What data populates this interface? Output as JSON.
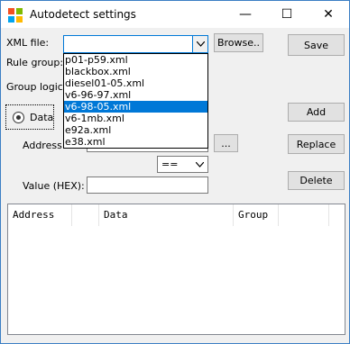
{
  "window": {
    "title": "Autodetect settings",
    "minimize": "—",
    "maximize": "☐",
    "close": "✕"
  },
  "labels": {
    "xml_file": "XML file:",
    "rule_group": "Rule group:",
    "group_logic": "Group logic:",
    "data": "Data",
    "address": "Address:",
    "value_hex": "Value (HEX):"
  },
  "buttons": {
    "browse": "Browse..",
    "save": "Save",
    "add": "Add",
    "replace": "Replace",
    "delete": "Delete",
    "ellipsis": "..."
  },
  "xml_combo": {
    "value": ""
  },
  "xml_options": [
    "p01-p59.xml",
    "blackbox.xml",
    "diesel01-05.xml",
    "v6-96-97.xml",
    "v6-98-05.xml",
    "v6-1mb.xml",
    "e92a.xml",
    "e38.xml"
  ],
  "xml_selected": "v6-98-05.xml",
  "operator": {
    "value": "=="
  },
  "value_hex_input": {
    "value": ""
  },
  "list_columns": [
    "Address",
    "",
    "Data",
    "Group",
    ""
  ]
}
